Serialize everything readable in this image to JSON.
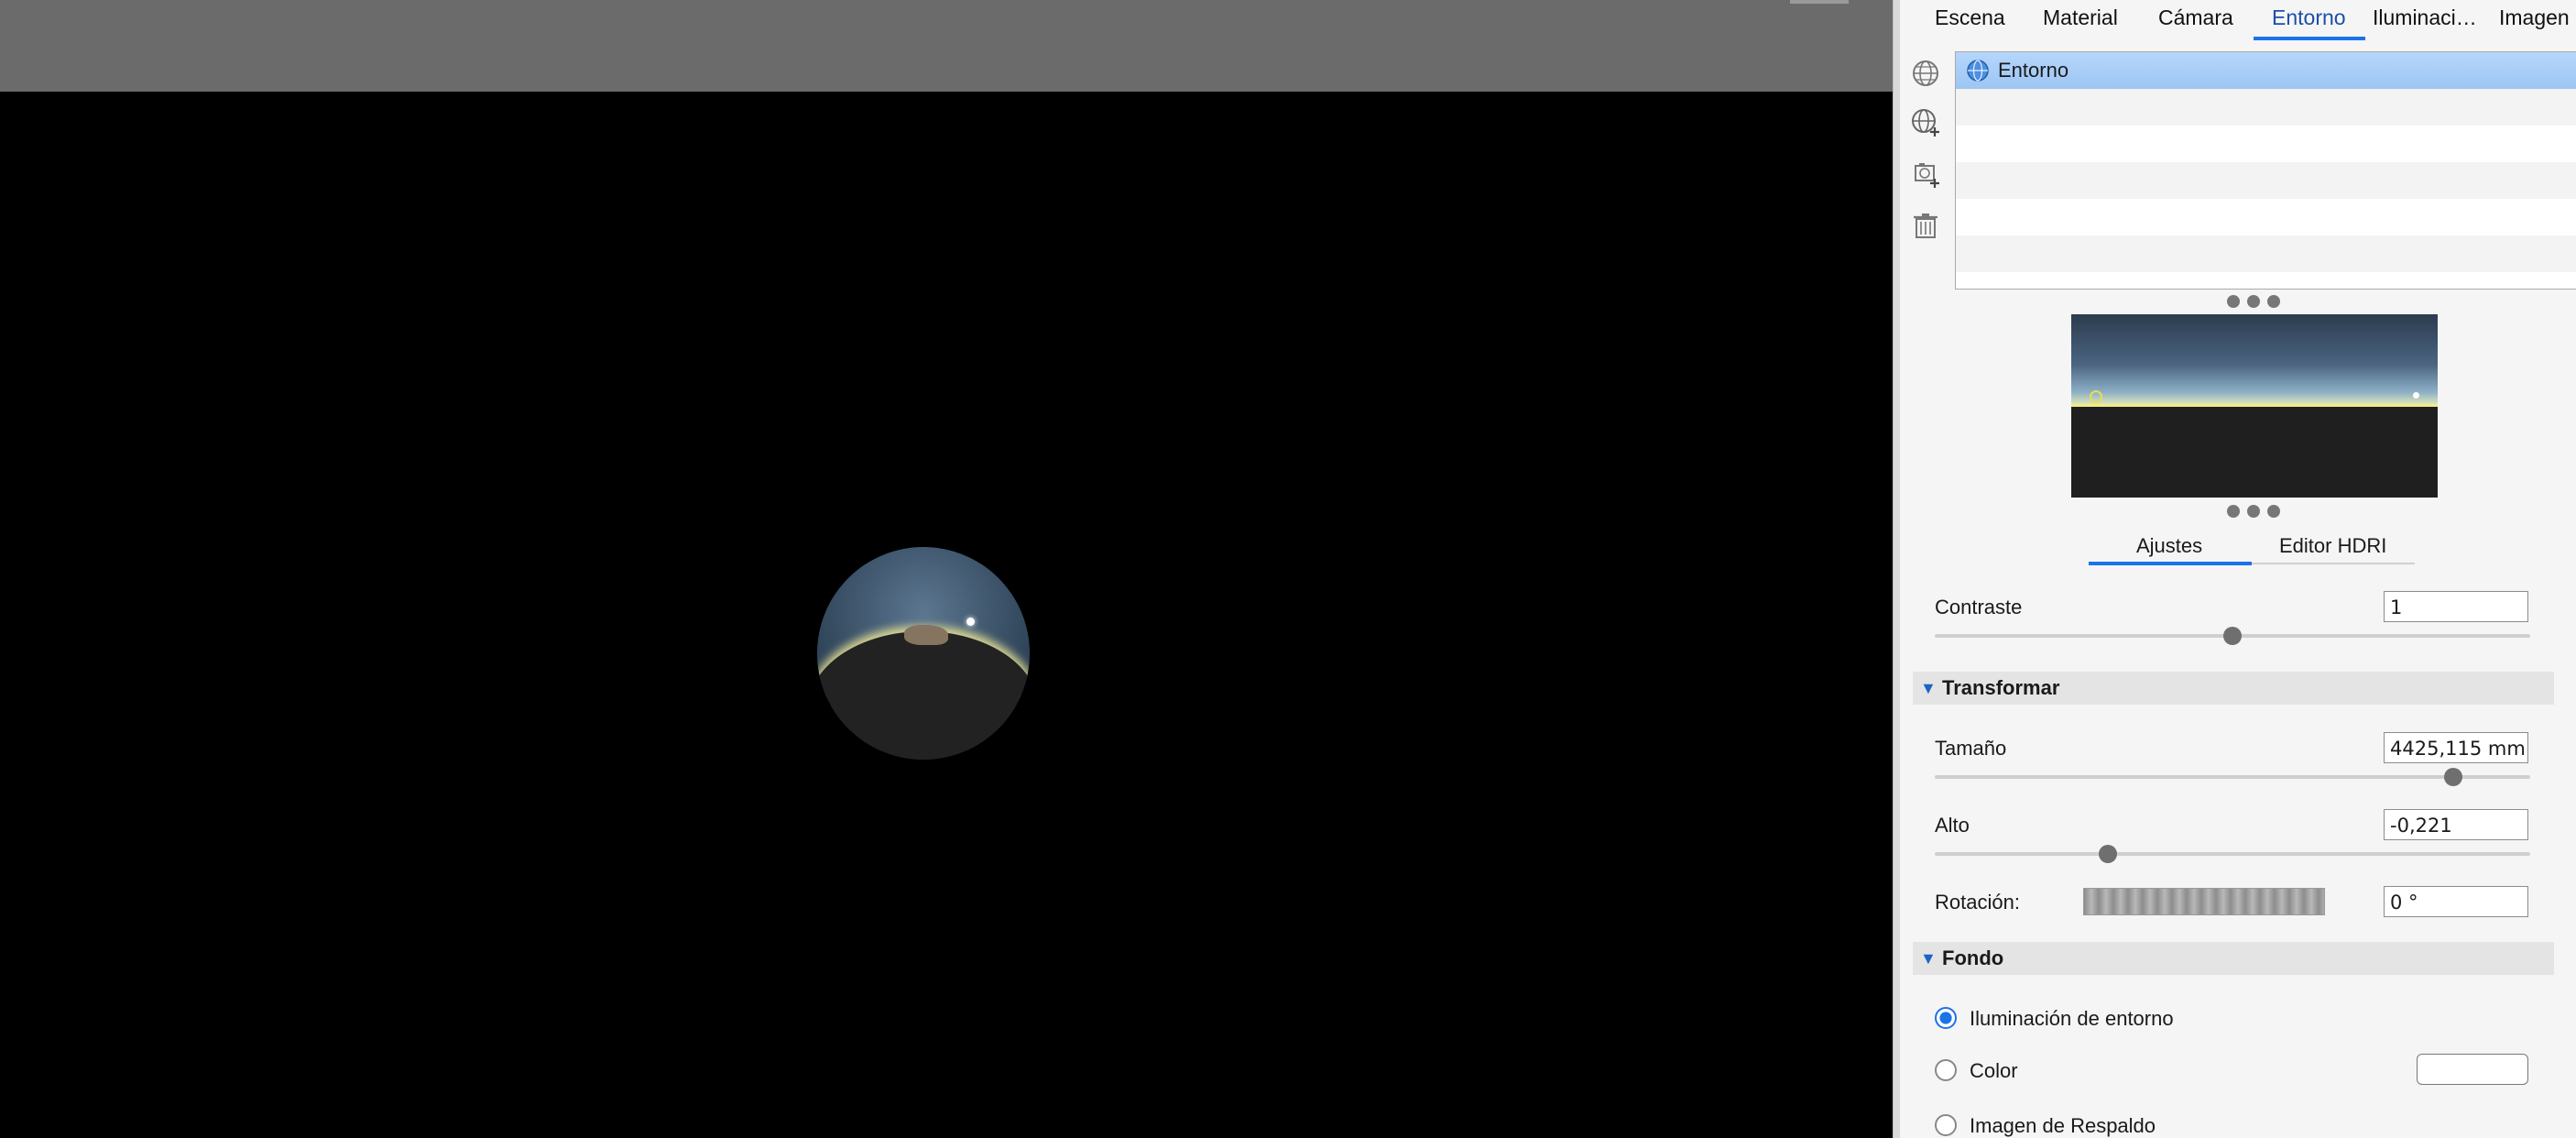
{
  "tabs": [
    "Escena",
    "Material",
    "Cámara",
    "Entorno",
    "Iluminaci…",
    "Imagen"
  ],
  "active_tab": "Entorno",
  "environment_list": {
    "items": [
      "Entorno"
    ],
    "selected": "Entorno"
  },
  "side_icons": [
    "globe-icon",
    "add-globe-icon",
    "add-image-icon",
    "trash-icon"
  ],
  "subtabs": [
    "Ajustes",
    "Editor HDRI"
  ],
  "active_subtab": "Ajustes",
  "contraste": {
    "label": "Contraste",
    "value": "1",
    "slider_fraction": 0.5
  },
  "transformar": {
    "title": "Transformar",
    "tamano": {
      "label": "Tamaño",
      "value": "4425,115 mm",
      "slider_fraction": 0.87
    },
    "alto": {
      "label": "Alto",
      "value": "-0,221",
      "slider_fraction": 0.29
    },
    "rotacion": {
      "label": "Rotación:",
      "value": "0 °"
    }
  },
  "fondo": {
    "title": "Fondo",
    "options": [
      "Iluminación de entorno",
      "Color",
      "Imagen de Respaldo"
    ],
    "selected": "Iluminación de entorno",
    "color_swatch": "#ffffff"
  },
  "colors": {
    "accent": "#1a73e8",
    "selection": "#a9cdf7"
  }
}
